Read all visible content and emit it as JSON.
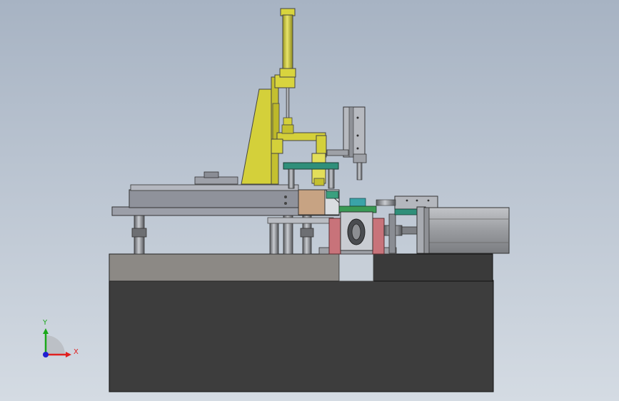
{
  "viewport": {
    "background_top": "#a7b3c3",
    "background_bottom": "#d4dbe3"
  },
  "triad": {
    "x_label": "X",
    "y_label": "Y",
    "x_color": "#e02020",
    "y_color": "#1aa81a",
    "z_color": "#2020d0"
  },
  "colors": {
    "frame_dark": "#3d3d3d",
    "frame_top_left": "#8c8985",
    "plate_gray": "#9c9fa8",
    "cylinder_yellow": "#d4d03a",
    "bracket_green": "#2f8f7a",
    "clamp_red": "#c8737a",
    "block_tan": "#c7a383",
    "motor_gray": "#a4a6aa"
  }
}
